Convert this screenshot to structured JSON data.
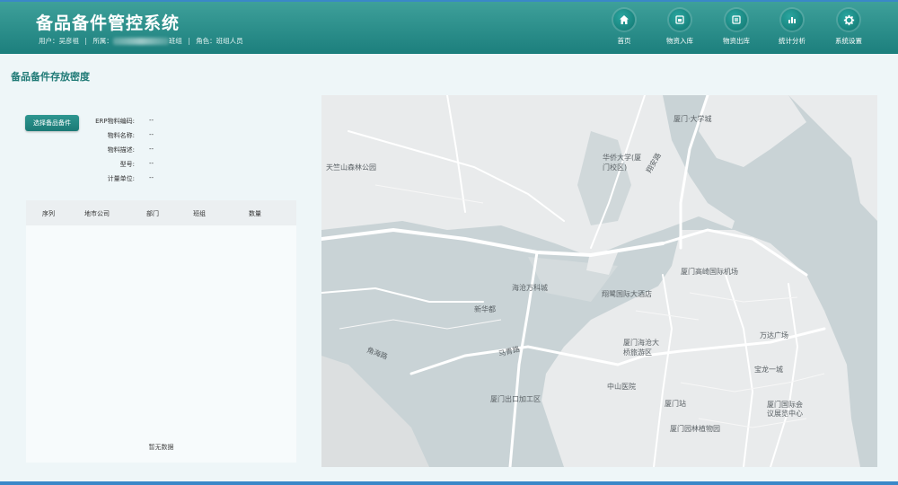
{
  "header": {
    "title": "备品备件管控系统",
    "user_label": "用户：",
    "user_name": "吴彦祖",
    "org_label": "所属：",
    "org_suffix": "班组",
    "role_label": "角色：",
    "role_value": "班组人员",
    "nav": [
      {
        "label": "首页",
        "icon": "home-icon"
      },
      {
        "label": "物资入库",
        "icon": "inbound-icon"
      },
      {
        "label": "物资出库",
        "icon": "outbound-icon"
      },
      {
        "label": "统计分析",
        "icon": "bar-chart-icon"
      },
      {
        "label": "系统设置",
        "icon": "gear-icon"
      }
    ]
  },
  "page": {
    "title": "备品备件存放密度",
    "select_button": "选择备品备件",
    "info": [
      {
        "label": "ERP物料编码:",
        "value": "--"
      },
      {
        "label": "物料名称:",
        "value": "--"
      },
      {
        "label": "物料描述:",
        "value": "--"
      },
      {
        "label": "型号:",
        "value": "--"
      },
      {
        "label": "计量单位:",
        "value": "--"
      }
    ],
    "table": {
      "columns": [
        "序列",
        "地市公司",
        "部门",
        "班组",
        "数量"
      ],
      "empty_text": "暂无数据"
    }
  },
  "map": {
    "labels": [
      "厦门·大学城",
      "华侨大学(厦门校区)",
      "天竺山森林公园",
      "厦门高崎国际机场",
      "翔鹭国际大酒店",
      "海沧万科城",
      "新华都",
      "厦门海沧大桥旅游区",
      "万达广场",
      "宝龙一城",
      "中山医院",
      "厦门站",
      "厦门国际会议展览中心",
      "厦门园林植物园",
      "厦门出口加工区",
      "马青路",
      "角海路",
      "翔安路"
    ]
  },
  "colors": {
    "header": "#1c7f7d",
    "accent": "#1f7a76",
    "water": "#c9d3d6",
    "land": "#e9ebec"
  }
}
